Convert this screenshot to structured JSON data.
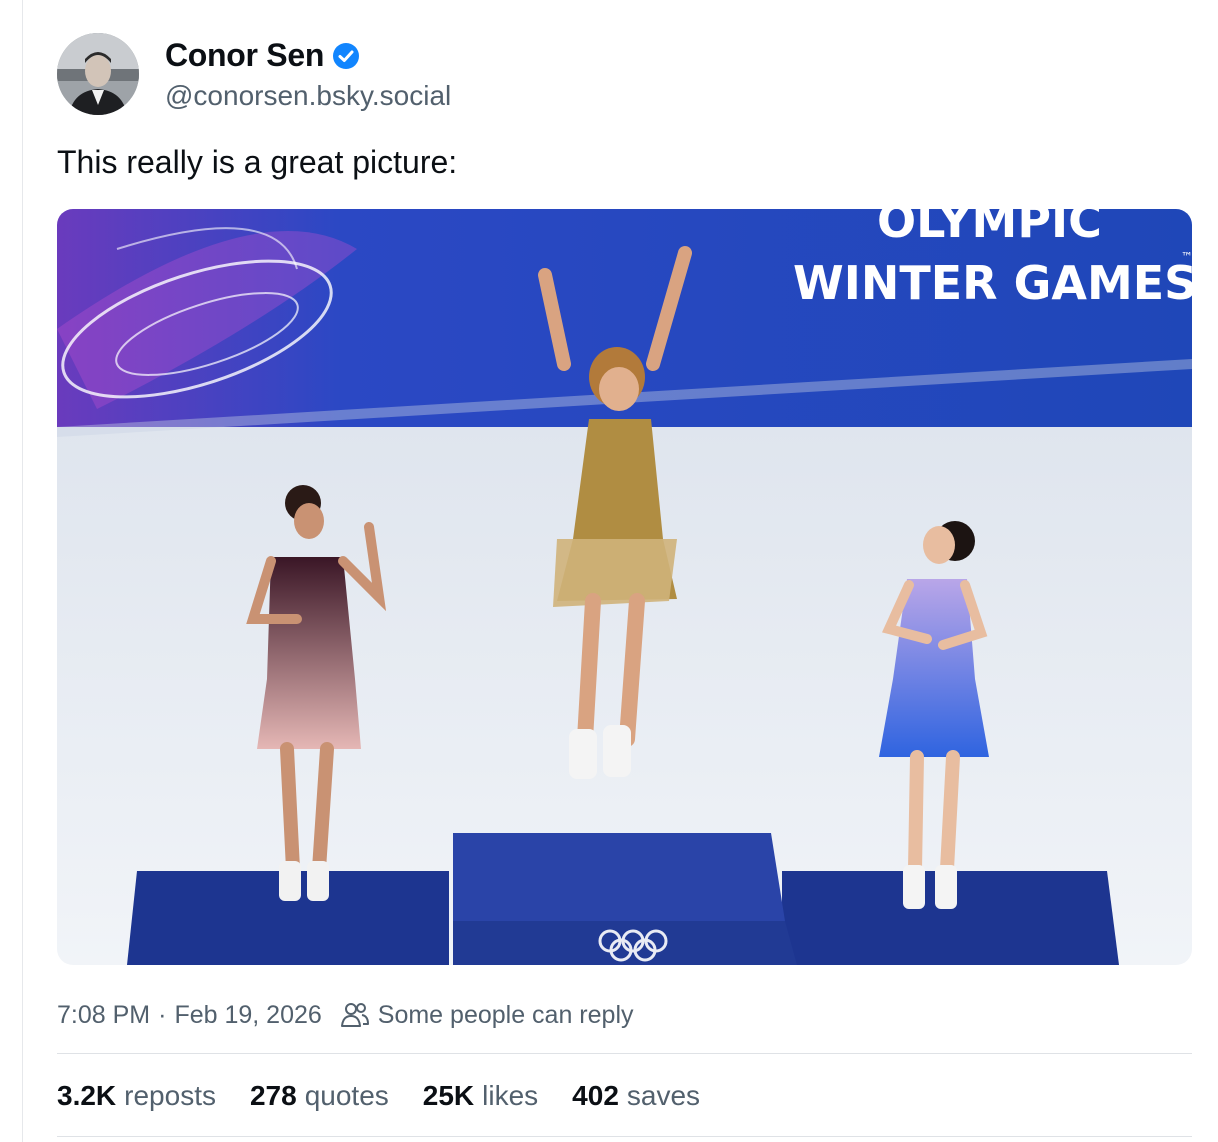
{
  "author": {
    "display_name": "Conor Sen",
    "handle": "@conorsen.bsky.social",
    "verified_icon": "verified-badge-icon",
    "avatar_icon": "avatar-photo"
  },
  "post": {
    "text": "This really is a great picture:"
  },
  "media": {
    "banner_line1": "OLYMPIC",
    "banner_line2": "WINTER GAMES",
    "banner_mark": "™",
    "colors": {
      "banner": "#1f47b8",
      "ice": "#e9eef5",
      "podium": "#213a94"
    }
  },
  "meta": {
    "time": "7:08 PM",
    "separator": "·",
    "date": "Feb 19, 2026",
    "reply_icon": "people-icon",
    "reply_setting": "Some people can reply"
  },
  "stats": {
    "reposts": {
      "value": "3.2K",
      "label": "reposts"
    },
    "quotes": {
      "value": "278",
      "label": "quotes"
    },
    "likes": {
      "value": "25K",
      "label": "likes"
    },
    "saves": {
      "value": "402",
      "label": "saves"
    }
  },
  "colors": {
    "accent": "#1185fe",
    "muted_text": "#52606d",
    "text": "#0b0f14"
  }
}
